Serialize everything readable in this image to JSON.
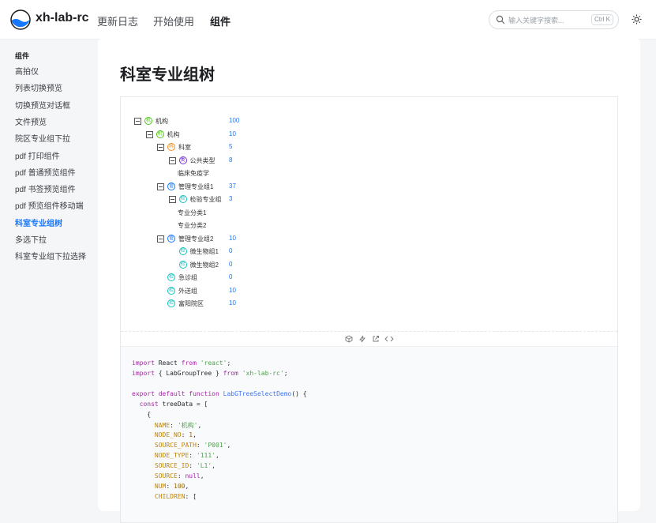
{
  "header": {
    "brand": "xh-lab-rc",
    "nav": [
      "更新日志",
      "开始使用",
      "组件"
    ],
    "search_placeholder": "输入关键字搜索...",
    "search_shortcut": "Ctrl K"
  },
  "sidebar": {
    "group": "组件",
    "items": [
      "高拍仪",
      "列表切换预览",
      "切换预览对话框",
      "文件预览",
      "院区专业组下拉",
      "pdf 打印组件",
      "pdf 普通预览组件",
      "pdf 书签预览组件",
      "pdf 预览组件移动端",
      "科室专业组树",
      "多选下拉",
      "科室专业组下拉选择"
    ],
    "active_index": 9
  },
  "page": {
    "title": "科室专业组树"
  },
  "tree": [
    {
      "label": "机构",
      "num": "100",
      "icon": "机",
      "color": "#52c41a",
      "toggle": true
    },
    {
      "label": "机构",
      "num": "10",
      "icon": "机",
      "color": "#52c41a",
      "toggle": true
    },
    {
      "label": "科室",
      "num": "5",
      "icon": "科",
      "color": "#fa8c16",
      "toggle": true
    },
    {
      "label": "公共类型",
      "num": "8",
      "icon": "类",
      "color": "#722ed1",
      "toggle": true
    },
    {
      "label": "临床免疫学",
      "num": "",
      "icon": "",
      "color": "",
      "toggle": false
    },
    {
      "label": "管理专业组1",
      "num": "37",
      "icon": "管",
      "color": "#1677ff",
      "toggle": true
    },
    {
      "label": "检验专业组",
      "num": "3",
      "icon": "检",
      "color": "#13c2c2",
      "toggle": true
    },
    {
      "label": "专业分类1",
      "num": "",
      "icon": "",
      "color": "",
      "toggle": false
    },
    {
      "label": "专业分类2",
      "num": "",
      "icon": "",
      "color": "",
      "toggle": false
    },
    {
      "label": "管理专业组2",
      "num": "10",
      "icon": "管",
      "color": "#1677ff",
      "toggle": true
    },
    {
      "label": "微生物组1",
      "num": "0",
      "icon": "检",
      "color": "#13c2c2",
      "toggle": false
    },
    {
      "label": "微生物组2",
      "num": "0",
      "icon": "检",
      "color": "#13c2c2",
      "toggle": false
    },
    {
      "label": "急诊组",
      "num": "0",
      "icon": "检",
      "color": "#13c2c2",
      "toggle": false
    },
    {
      "label": "外送组",
      "num": "10",
      "icon": "检",
      "color": "#13c2c2",
      "toggle": false
    },
    {
      "label": "富阳院区",
      "num": "10",
      "icon": "检",
      "color": "#13c2c2",
      "toggle": false
    }
  ],
  "code": [
    "import React from 'react';",
    "import { LabGroupTree } from 'xh-lab-rc';",
    "",
    "export default function LabGTreeSelectDemo() {",
    "  const treeData = [",
    "    {",
    "      NAME: '机构',",
    "      NODE_NO: 1,",
    "      SOURCE_PATH: 'P001',",
    "      NODE_TYPE: '111',",
    "      SOURCE_ID: 'L1',",
    "      SOURCE: null,",
    "      NUM: 100,",
    "      CHILDREN: ["
  ]
}
